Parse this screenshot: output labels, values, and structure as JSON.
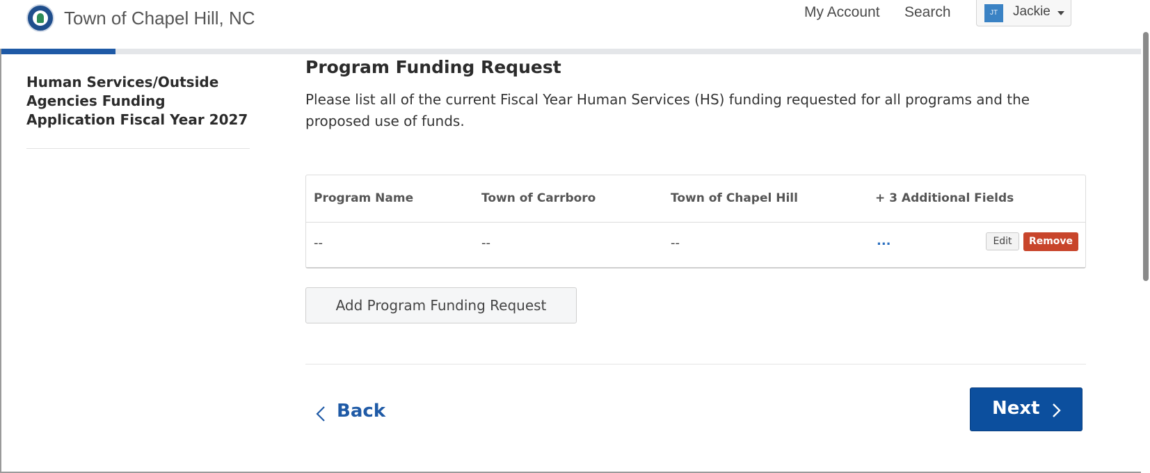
{
  "header": {
    "site_title": "Town of Chapel Hill, NC",
    "nav": {
      "account": "My Account",
      "search": "Search"
    },
    "user": {
      "initials": "JT",
      "name": "Jackie"
    }
  },
  "progress": {
    "percent": 10
  },
  "sidebar": {
    "title": "Human Services/Outside Agencies Funding Application Fiscal Year 2027"
  },
  "main": {
    "title": "Program Funding Request",
    "description": "Please list all of the current Fiscal Year Human Services (HS) funding requested for all programs and the proposed use of funds.",
    "table": {
      "columns": [
        "Program Name",
        "Town of Carrboro",
        "Town of Chapel Hill",
        "+ 3 Additional Fields"
      ],
      "rows": [
        {
          "cells": [
            "--",
            "--",
            "--",
            "..."
          ]
        }
      ],
      "edit_label": "Edit",
      "remove_label": "Remove"
    },
    "add_button": "Add Program Funding Request",
    "back_button": "Back",
    "next_button": "Next"
  },
  "colors": {
    "primary": "#0c4f9e",
    "link": "#1f5aa6",
    "danger": "#c8452b",
    "progress_track": "#e4e6e9"
  }
}
